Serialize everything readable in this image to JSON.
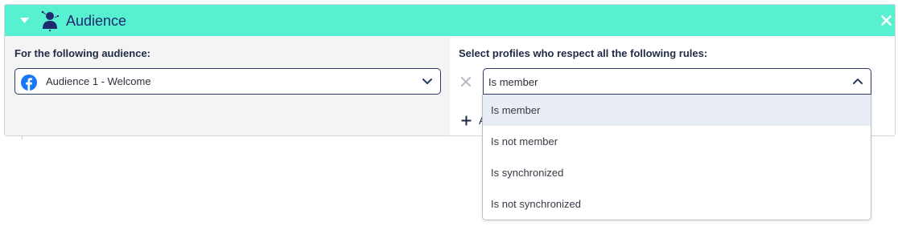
{
  "header": {
    "title": "Audience",
    "background": "#57f0d1",
    "icons": {
      "collapse": "caret-down-icon",
      "section": "audience-person-icon",
      "close": "close-icon"
    }
  },
  "left": {
    "label": "For the following audience:",
    "select": {
      "value": "Audience 1 - Welcome",
      "icon": "facebook-icon"
    }
  },
  "right": {
    "label": "Select profiles who respect all the following rules:",
    "rule": {
      "value": "Is member"
    },
    "add_label": "A"
  },
  "dropdown": {
    "options": [
      {
        "label": "Is member",
        "active": true
      },
      {
        "label": "Is not member",
        "active": false
      },
      {
        "label": "Is synchronized",
        "active": false
      },
      {
        "label": "Is not synchronized",
        "active": false
      }
    ]
  },
  "colors": {
    "accent": "#57f0d1",
    "facebook": "#1877f2",
    "border": "#2b3a63"
  }
}
